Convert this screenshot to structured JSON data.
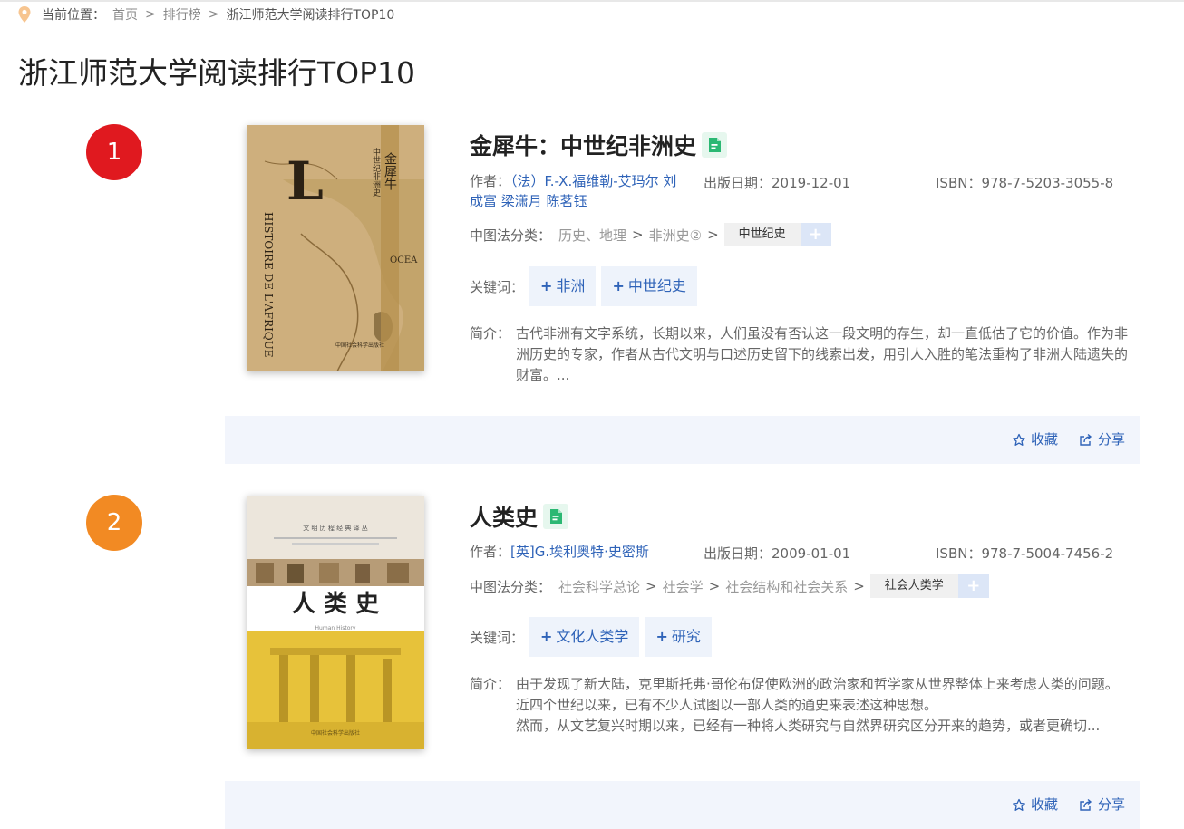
{
  "breadcrumb": {
    "label": "当前位置：",
    "items": [
      "首页",
      "排行榜"
    ],
    "separator": ">",
    "current": "浙江师范大学阅读排行TOP10"
  },
  "page_title": "浙江师范大学阅读排行TOP10",
  "labels": {
    "author": "作者：",
    "pub_date": "出版日期：",
    "isbn": "ISBN：",
    "classification": "中图法分类：",
    "keywords": "关键词：",
    "summary": "简介："
  },
  "actions": {
    "favorite": "收藏",
    "share": "分享"
  },
  "books": [
    {
      "rank": "1",
      "rank_color": "#e0191f",
      "title": "金犀牛：中世纪非洲史",
      "authors": "（法）F.-X.福维勒-艾玛尔 刘成富 梁潇月 陈茗钰",
      "pub_date": "2019-12-01",
      "isbn": "978-7-5203-3055-8",
      "classification": [
        "历史、地理",
        "非洲史②"
      ],
      "class_tag": "中世纪史",
      "keywords": [
        "非洲",
        "中世纪史"
      ],
      "summary": "古代非洲有文字系统，长期以来，人们虽没有否认这一段文明的存生，却一直低估了它的价值。作为非洲历史的专家，作者从古代文明与口述历史留下的线索出发，用引人入胜的笔法重构了非洲大陆遗失的财富。...",
      "cover": {
        "letter": "L",
        "vertical_title": "金犀牛",
        "vertical_sub": "中世纪非洲史",
        "side_text": "HISTOIRE DE L'AFRIQUE",
        "map_label": "OCEA",
        "publisher": "中国社会科学出版社"
      }
    },
    {
      "rank": "2",
      "rank_color": "#f28a23",
      "title": "人类史",
      "authors": "[英]G.埃利奥特·史密斯",
      "pub_date": "2009-01-01",
      "isbn": "978-7-5004-7456-2",
      "classification": [
        "社会科学总论",
        "社会学",
        "社会结构和社会关系"
      ],
      "class_tag": "社会人类学",
      "keywords": [
        "文化人类学",
        "研究"
      ],
      "summary": "由于发现了新大陆，克里斯托弗·哥伦布促使欧洲的政治家和哲学家从世界整体上来考虑人类的问题。近四个世纪以来，已有不少人试图以一部人类的通史来表述这种思想。\n然而，从文艺复兴时期以来，已经有一种将人类研究与自然界研究区分开来的趋势，或者更确切...",
      "cover": {
        "series": "文 明 历 程 经 典 译 丛",
        "title": "人 类 史",
        "english": "Human History",
        "publisher": "中国社会科学出版社"
      }
    }
  ]
}
